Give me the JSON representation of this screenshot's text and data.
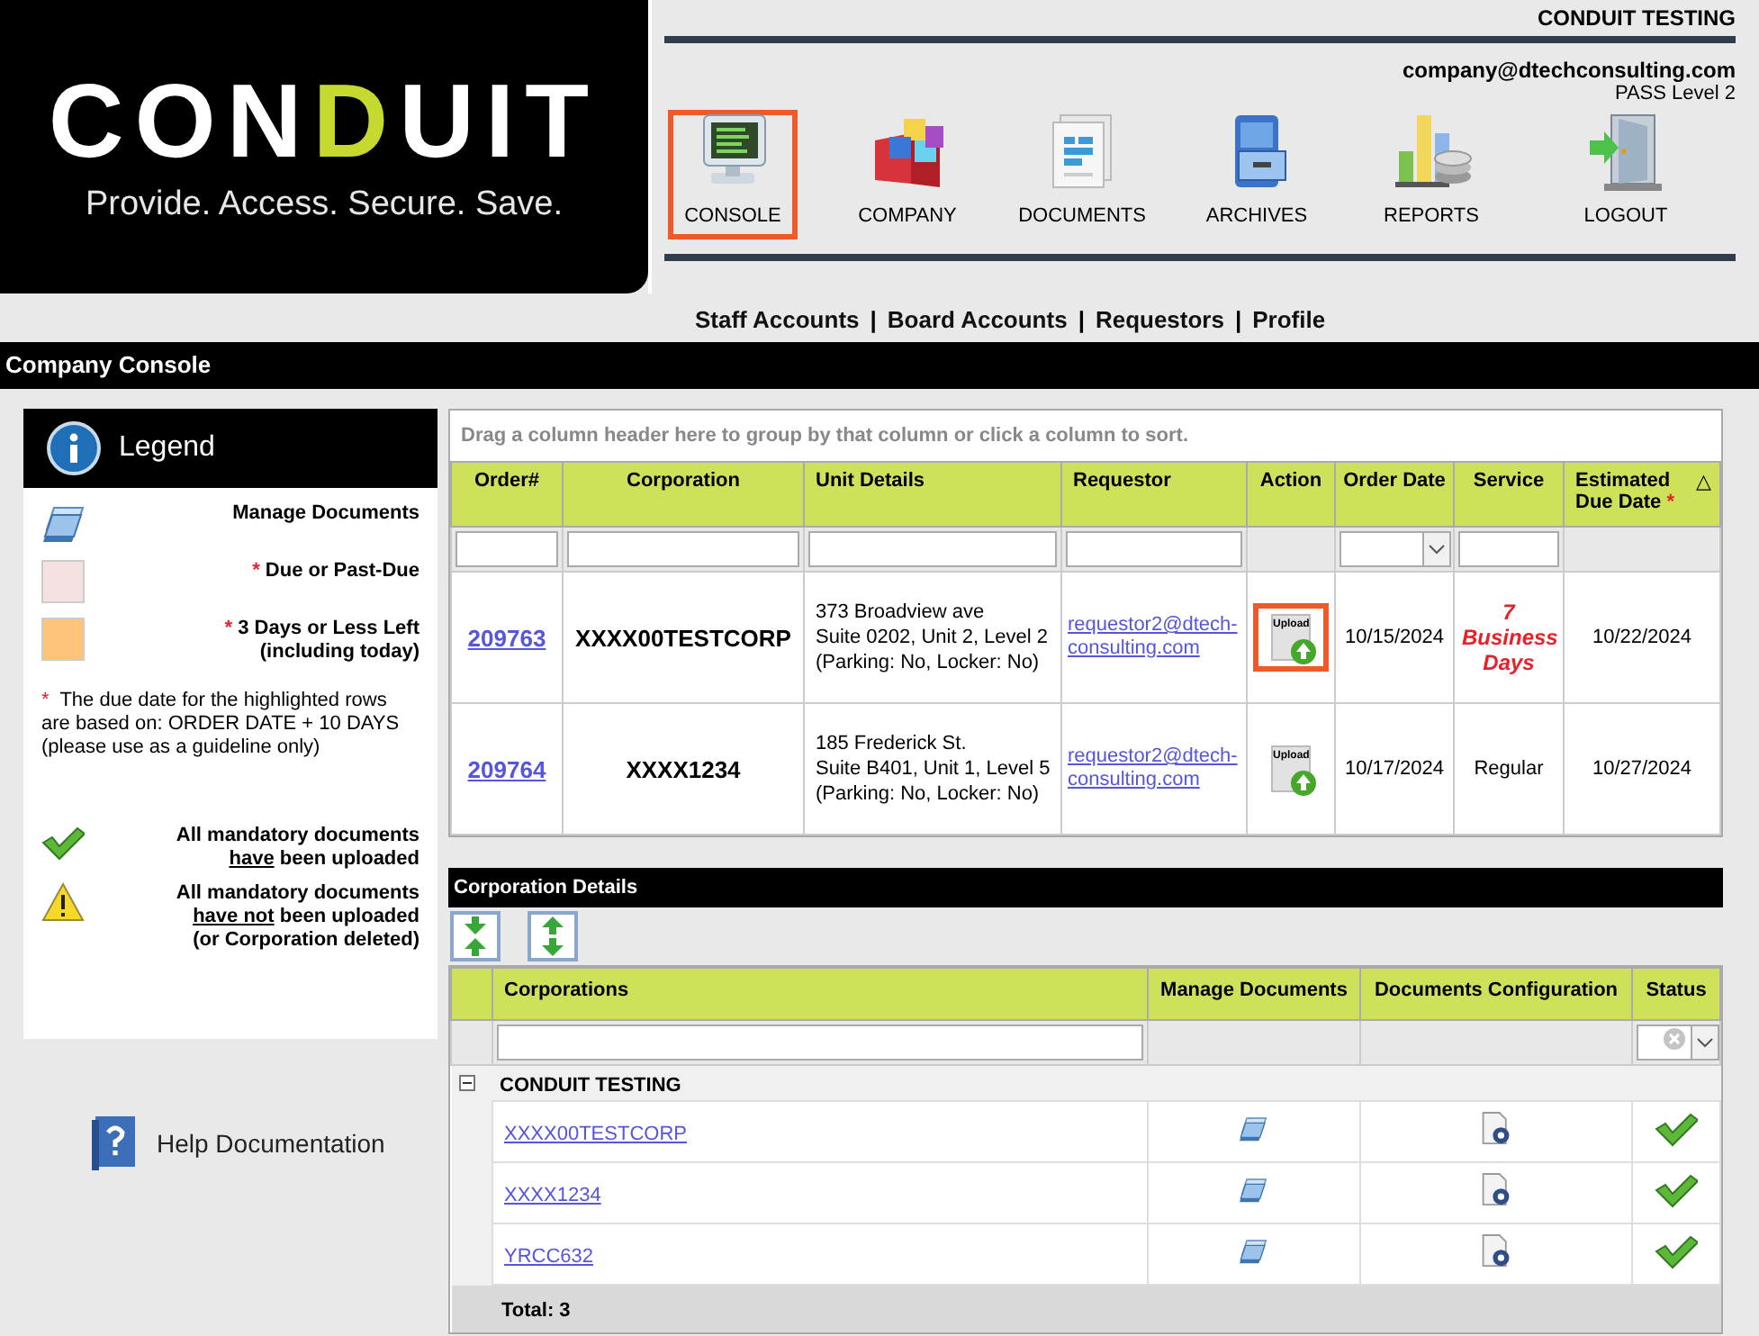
{
  "header": {
    "logo": {
      "parts": [
        {
          "text": "CON",
          "accent": false
        },
        {
          "text": "D",
          "accent": true
        },
        {
          "text": "UIT",
          "accent": false
        }
      ],
      "tagline": "Provide. Access. Secure. Save."
    },
    "account_title": "CONDUIT TESTING",
    "email": "company@dtechconsulting.com",
    "level": "PASS Level 2"
  },
  "nav": [
    {
      "label": "CONSOLE",
      "selected": true
    },
    {
      "label": "COMPANY",
      "selected": false
    },
    {
      "label": "DOCUMENTS",
      "selected": false
    },
    {
      "label": "ARCHIVES",
      "selected": false
    },
    {
      "label": "REPORTS",
      "selected": false
    },
    {
      "label": "LOGOUT",
      "selected": false
    }
  ],
  "sub_links": {
    "separator": "|",
    "items": [
      "Staff Accounts",
      "Board Accounts",
      "Requestors",
      "Profile"
    ]
  },
  "section_title": "Company Console",
  "legend": {
    "title": "Legend",
    "items": [
      {
        "kind": "documents",
        "lines": [
          [
            {
              "text": "Manage Documents"
            }
          ]
        ]
      },
      {
        "kind": "swatch",
        "color": "#f5e1e1",
        "mark": "*",
        "lines": [
          [
            {
              "text": "Due or Past-Due"
            }
          ]
        ]
      },
      {
        "kind": "swatch",
        "color": "#ffc379",
        "mark": "*",
        "lines": [
          [
            {
              "text": "3 Days or Less Left"
            }
          ],
          [
            {
              "text": "(including today)"
            }
          ]
        ]
      }
    ],
    "note_mark": "*",
    "note": "The due date for the highlighted rows are based on: ORDER DATE + 10 DAYS (please use as a guideline only)",
    "status_items": [
      {
        "kind": "check",
        "lines": [
          [
            {
              "text": "All mandatory documents"
            }
          ],
          [
            {
              "text": "have",
              "underline": true
            },
            {
              "text": " been uploaded",
              "underline": false
            }
          ]
        ]
      },
      {
        "kind": "warning",
        "lines": [
          [
            {
              "text": "All mandatory documents"
            }
          ],
          [
            {
              "text": "have not",
              "underline": true
            },
            {
              "text": " been uploaded",
              "underline": false
            }
          ],
          [
            {
              "text": "(or Corporation deleted)"
            }
          ]
        ]
      }
    ]
  },
  "help": {
    "label": "Help Documentation"
  },
  "orders": {
    "group_hint": "Drag a column header here to group by that column or click a column to sort.",
    "columns": [
      {
        "label": "Order#"
      },
      {
        "label": "Corporation"
      },
      {
        "label": "Unit Details"
      },
      {
        "label": "Requestor"
      },
      {
        "label": "Action"
      },
      {
        "label": "Order Date"
      },
      {
        "label": "Service"
      },
      {
        "label": "Estimated Due Date",
        "mark": "*",
        "sort_indicator": "△"
      }
    ],
    "filters": [
      {
        "kind": "text"
      },
      {
        "kind": "text"
      },
      {
        "kind": "text"
      },
      {
        "kind": "text"
      },
      {
        "kind": "none"
      },
      {
        "kind": "select"
      },
      {
        "kind": "text"
      },
      {
        "kind": "none"
      }
    ],
    "rows": [
      {
        "order": "209763",
        "corporation": "XXXX00TESTCORP",
        "unit_details": [
          "373 Broadview ave",
          "Suite 0202, Unit 2, Level 2",
          "(Parking: No, Locker: No)"
        ],
        "requestor": "requestor2@dtech-consulting.com",
        "action": {
          "label": "Upload",
          "highlighted": true
        },
        "order_date": "10/15/2024",
        "service": {
          "text": "7 Business Days",
          "urgent": true
        },
        "due_date": "10/22/2024"
      },
      {
        "order": "209764",
        "corporation": "XXXX1234",
        "unit_details": [
          "185 Frederick St.",
          "Suite B401, Unit 1, Level 5",
          "(Parking: No, Locker: No)"
        ],
        "requestor": "requestor2@dtech-consulting.com",
        "action": {
          "label": "Upload",
          "highlighted": false
        },
        "order_date": "10/17/2024",
        "service": {
          "text": "Regular",
          "urgent": false
        },
        "due_date": "10/27/2024"
      }
    ]
  },
  "corporation_details": {
    "title": "Corporation Details",
    "toolbar": [
      {
        "kind": "collapse"
      },
      {
        "kind": "expand"
      }
    ],
    "columns": [
      {
        "label": "Corporations"
      },
      {
        "label": "Manage Documents"
      },
      {
        "label": "Documents Configuration"
      },
      {
        "label": "Status"
      }
    ],
    "filters": [
      {
        "kind": "text"
      },
      {
        "kind": "none"
      },
      {
        "kind": "none"
      },
      {
        "kind": "status"
      }
    ],
    "group": {
      "label": "CONDUIT TESTING",
      "expanded": true,
      "rows": [
        {
          "name": "XXXX00TESTCORP",
          "uploaded": true
        },
        {
          "name": "XXXX1234",
          "uploaded": true
        },
        {
          "name": "YRCC632",
          "uploaded": true
        }
      ]
    },
    "footer": "Total: 3"
  }
}
